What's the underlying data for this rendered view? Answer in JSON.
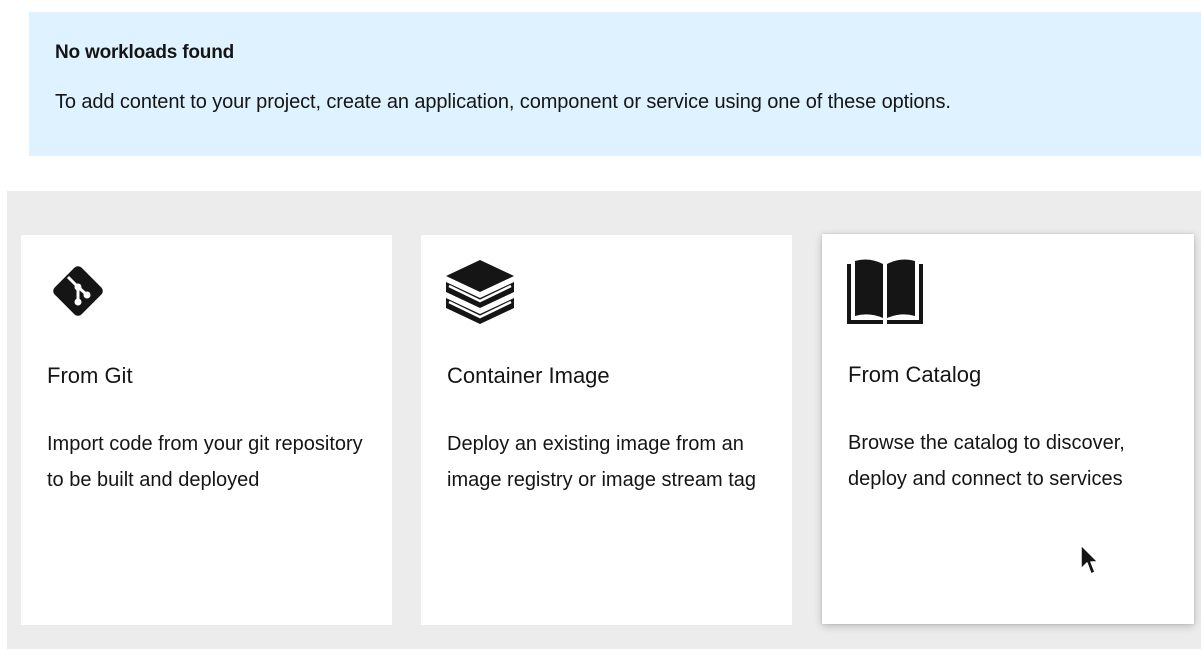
{
  "alert": {
    "title": "No workloads found",
    "body": "To add content to your project, create an application, component or service using one of these options."
  },
  "tiles": [
    {
      "icon": "git-icon",
      "title": "From Git",
      "description": "Import code from your git repository to be built and deployed"
    },
    {
      "icon": "layers-icon",
      "title": "Container Image",
      "description": "Deploy an existing image from an image registry or image stream tag"
    },
    {
      "icon": "book-open-icon",
      "title": "From Catalog",
      "description": "Browse the catalog to discover, deploy and connect to services"
    }
  ],
  "colors": {
    "alert_bg": "#def3ff",
    "tiles_area_bg": "#ececec",
    "text": "#151515"
  }
}
